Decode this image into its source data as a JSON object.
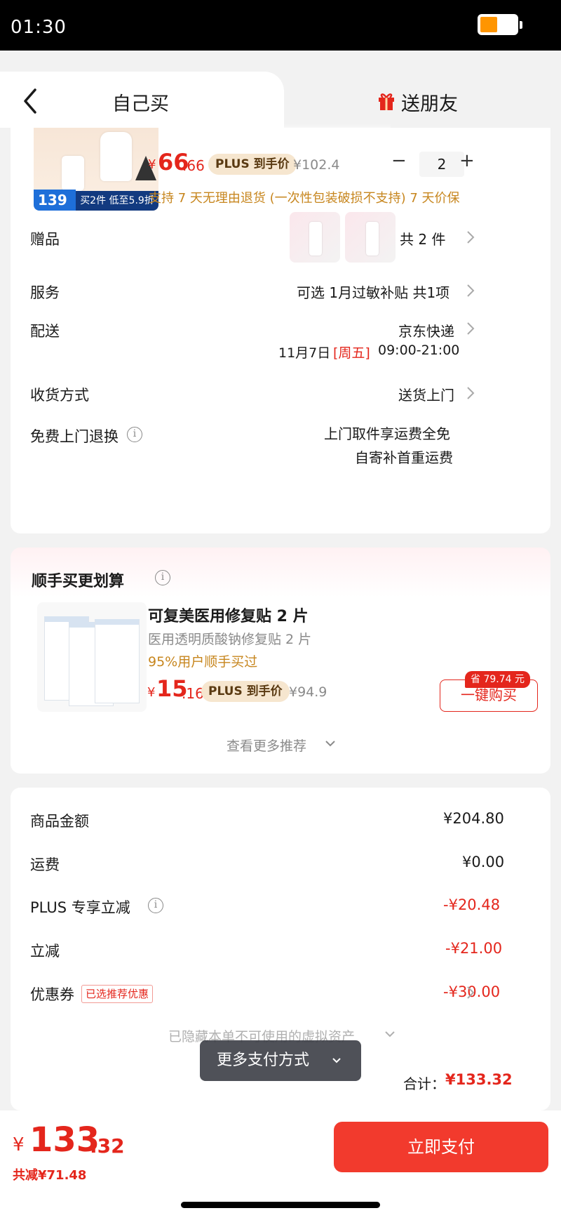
{
  "status_bar": {
    "time": "01:30"
  },
  "tabs": {
    "self": "自己买",
    "gift": "送朋友"
  },
  "product": {
    "image_price": "139",
    "image_deal": "买2件 低至5.9折",
    "price_symbol": "¥",
    "price_int": "66",
    "price_dec": ".66",
    "plus_label": "PLUS 到手价",
    "original_price": "¥102.4",
    "quantity": "2",
    "minus": "−",
    "plus": "+",
    "policy": "支持 7 天无理由退货 (一次性包装破损不支持)  7 天价保"
  },
  "gift": {
    "label": "赠品",
    "value": "共 2 件"
  },
  "service": {
    "label": "服务",
    "value": "可选 1月过敏补贴 共1项"
  },
  "delivery": {
    "label": "配送",
    "carrier": "京东快递",
    "date": "11月7日",
    "weekday": "[周五]",
    "time": "09:00-21:00"
  },
  "receive": {
    "label": "收货方式",
    "value": "送货上门"
  },
  "free_return": {
    "label": "免费上门退换",
    "line1": "上门取件享运费全免",
    "line2": "自寄补首重运费"
  },
  "recommend": {
    "title": "顺手买更划算",
    "product_name": "可复美医用修复贴 2 片",
    "product_desc": "医用透明质酸钠修复贴 2 片",
    "buy_rate": "95%用户顺手买过",
    "price_symbol": "¥",
    "price_int": "15",
    "price_dec": ".16",
    "plus_label": "PLUS 到手价",
    "original_price": "¥94.9",
    "save_tag": "省 79.74 元",
    "buy_button": "一键购买",
    "more": "查看更多推荐"
  },
  "summary": {
    "rows": [
      {
        "label": "商品金额",
        "value": "¥204.80"
      },
      {
        "label": "运费",
        "value": "¥0.00"
      },
      {
        "label": "PLUS 专享立减",
        "value": "-¥20.48"
      },
      {
        "label": "立减",
        "value": "-¥21.00"
      },
      {
        "label": "优惠券",
        "value": "-¥30.00"
      }
    ],
    "coupon_tag": "已选推荐优惠",
    "hidden_note": "已隐藏本单不可使用的虚拟资产",
    "total_label": "合计：",
    "total_value": "¥133.32"
  },
  "more_payment": "更多支付方式",
  "bottom": {
    "price_symbol": "¥",
    "price_int": "133",
    "price_dec": ".32",
    "saved": "共减¥71.48",
    "pay_button": "立即支付"
  },
  "colors": {
    "accent_red": "#e4261c",
    "pay_button": "#f23a2d",
    "plus_tag": "#f6e6cf",
    "orange_text": "#c7861e"
  }
}
